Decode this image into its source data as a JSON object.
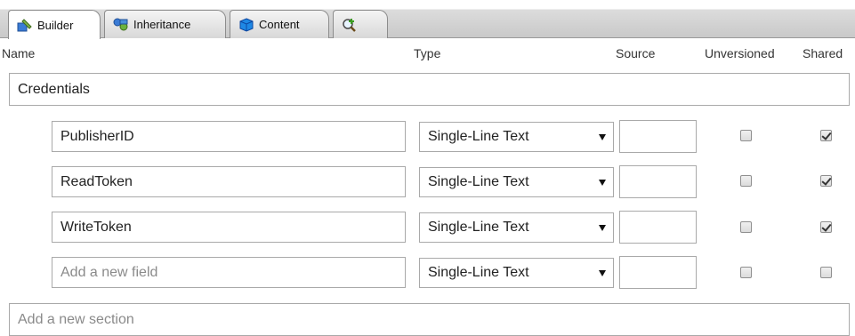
{
  "tabs": [
    {
      "label": "Builder",
      "icon": "builder-icon",
      "active": true
    },
    {
      "label": "Inheritance",
      "icon": "inheritance-icon",
      "active": false
    },
    {
      "label": "Content",
      "icon": "content-icon",
      "active": false
    },
    {
      "label": "",
      "icon": "search-add-icon",
      "active": false
    }
  ],
  "columns": {
    "name": "Name",
    "type": "Type",
    "source": "Source",
    "unversioned": "Unversioned",
    "shared": "Shared"
  },
  "section": {
    "name": "Credentials"
  },
  "fields": [
    {
      "name": "PublisherID",
      "type": "Single-Line Text",
      "source": "",
      "unversioned": false,
      "shared": true
    },
    {
      "name": "ReadToken",
      "type": "Single-Line Text",
      "source": "",
      "unversioned": false,
      "shared": true
    },
    {
      "name": "WriteToken",
      "type": "Single-Line Text",
      "source": "",
      "unversioned": false,
      "shared": true
    }
  ],
  "new_field": {
    "placeholder": "Add a new field",
    "type": "Single-Line Text",
    "unversioned": false,
    "shared": false
  },
  "new_section": {
    "placeholder": "Add a new section"
  },
  "colors": {
    "tab_bg": "#d4d4d4",
    "border": "#a9a9a9",
    "placeholder": "#8a8a8a"
  }
}
